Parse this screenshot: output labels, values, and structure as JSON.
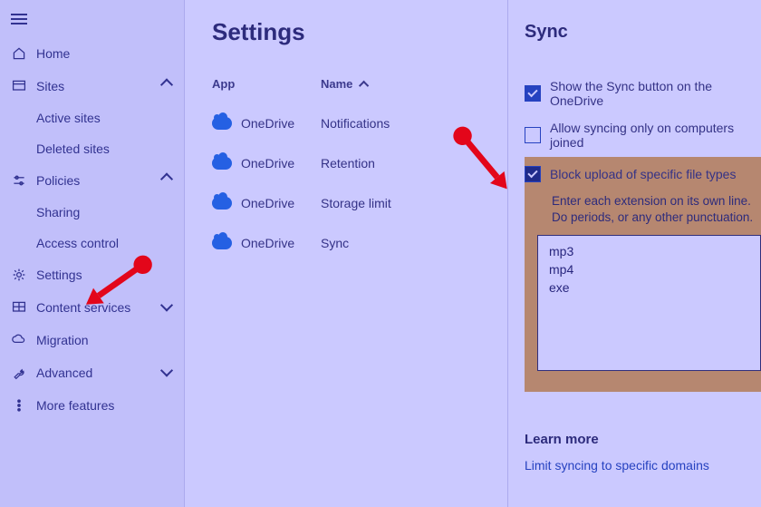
{
  "sidebar": {
    "home": "Home",
    "sites": {
      "label": "Sites",
      "active": "Active sites",
      "deleted": "Deleted sites"
    },
    "policies": {
      "label": "Policies",
      "sharing": "Sharing",
      "access": "Access control"
    },
    "settings": "Settings",
    "content_services": "Content services",
    "migration": "Migration",
    "advanced": "Advanced",
    "more_features": "More features"
  },
  "main": {
    "title": "Settings",
    "col_app": "App",
    "col_name": "Name",
    "rows": [
      {
        "app": "OneDrive",
        "name": "Notifications"
      },
      {
        "app": "OneDrive",
        "name": "Retention"
      },
      {
        "app": "OneDrive",
        "name": "Storage limit"
      },
      {
        "app": "OneDrive",
        "name": "Sync"
      }
    ]
  },
  "panel": {
    "title": "Sync",
    "opt_show_sync": "Show the Sync button on the OneDrive",
    "opt_allow_joined": "Allow syncing only on computers joined",
    "opt_block": "Block upload of specific file types",
    "hint": "Enter each extension on its own line. Do periods, or any other punctuation.",
    "ext_text": "mp3\nmp4\nexe",
    "learn_more": "Learn more",
    "link": "Limit syncing to specific domains"
  }
}
